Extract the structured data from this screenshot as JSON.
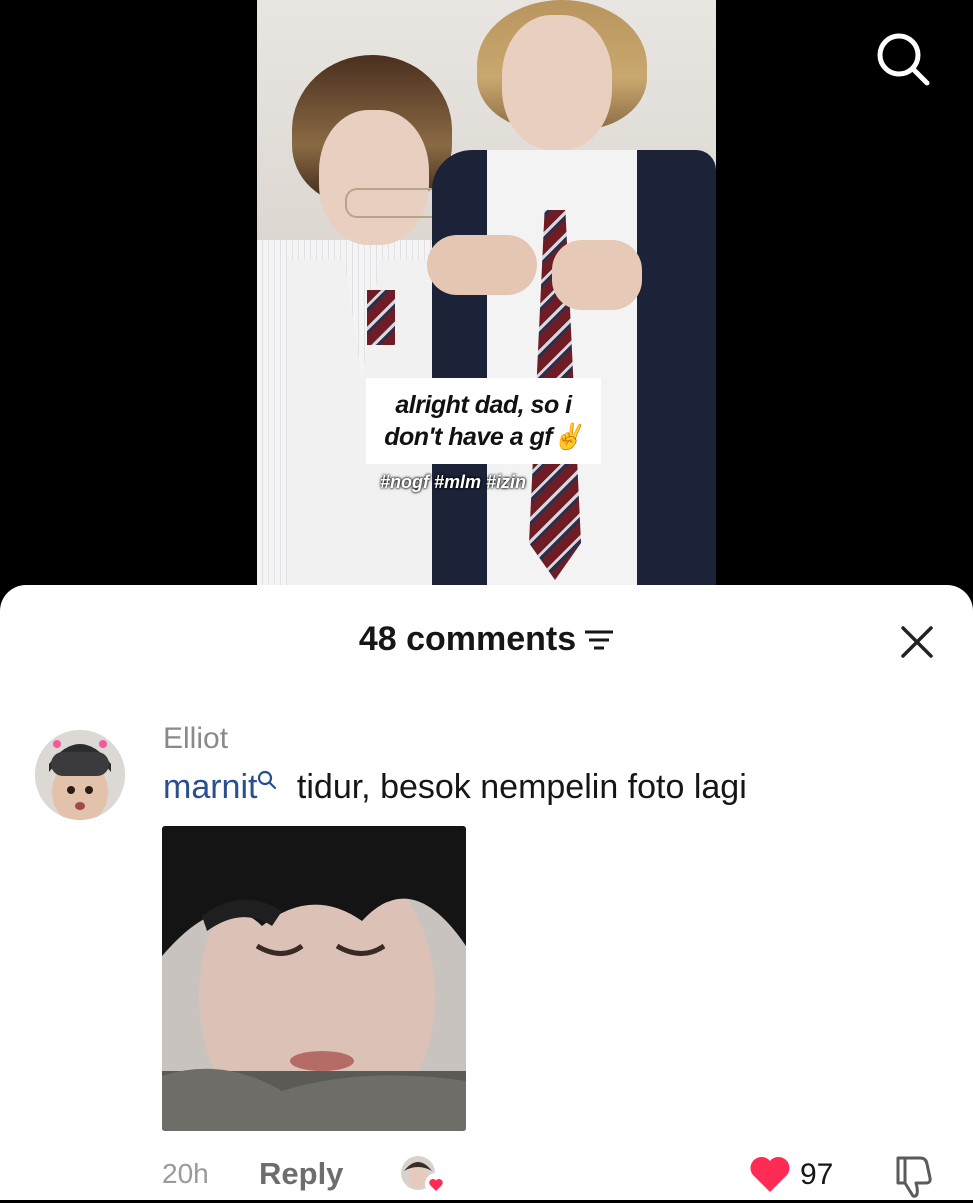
{
  "video": {
    "caption_lines": [
      "alright dad, so i",
      "don't have a gf✌️"
    ],
    "hashtags": "#nogf #mlm #izin",
    "search_icon": "search-icon"
  },
  "comments_sheet": {
    "title": "48 comments",
    "sort_icon": "filter-lines-icon",
    "close_icon": "close-icon"
  },
  "comment": {
    "author": "Elliot",
    "mention": "marnit",
    "text": " tidur, besok nempelin foto lagi",
    "time": "20h",
    "reply_label": "Reply",
    "like_count": "97",
    "colors": {
      "like": "#fe2c55",
      "mention": "#2a4f8f"
    }
  }
}
